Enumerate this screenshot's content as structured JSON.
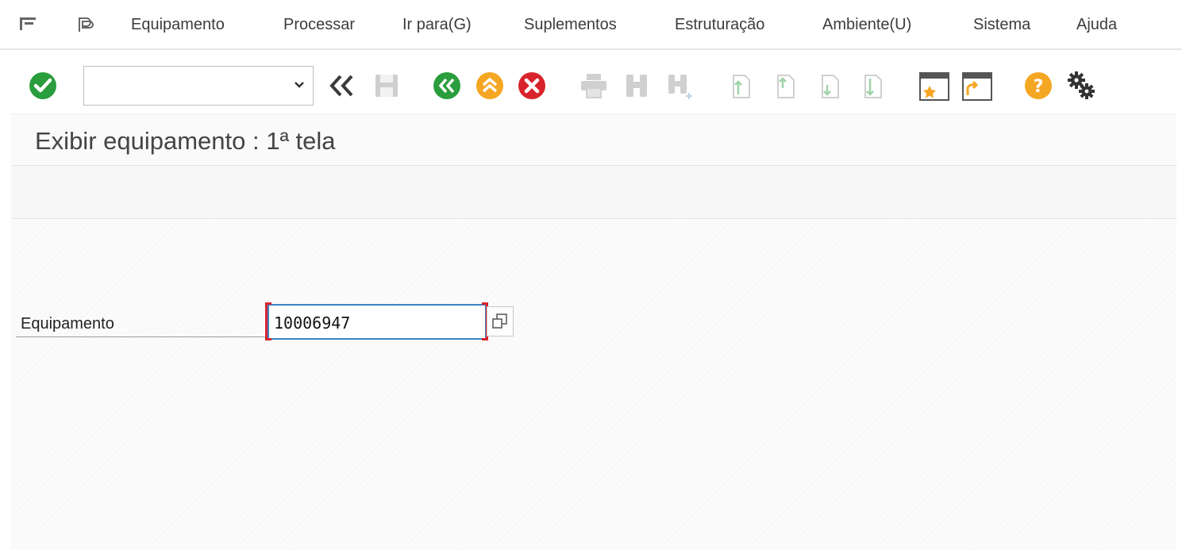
{
  "menu": {
    "items": [
      {
        "label": "Equipamento"
      },
      {
        "label": "Processar"
      },
      {
        "label": "Ir para(G)"
      },
      {
        "label": "Suplementos"
      },
      {
        "label": "Estruturação"
      },
      {
        "label": "Ambiente(U)"
      },
      {
        "label": "Sistema"
      },
      {
        "label": "Ajuda"
      }
    ],
    "icons": [
      "menu-toggle-icon",
      "session-icon"
    ]
  },
  "toolbar": {
    "command_field": {
      "value": "",
      "placeholder": ""
    },
    "icons": [
      "enter-icon",
      "command-dropdown-icon",
      "collapse-icon",
      "save-icon",
      "back-icon",
      "exit-icon",
      "cancel-icon",
      "print-icon",
      "find-icon",
      "find-next-icon",
      "first-page-icon",
      "previous-page-icon",
      "next-page-icon",
      "last-page-icon",
      "create-session-icon",
      "shortcut-icon",
      "help-icon",
      "settings-icon"
    ]
  },
  "title": "Exibir equipamento : 1ª tela",
  "form": {
    "equipment_label": "Equipamento",
    "equipment_value": "10006947"
  },
  "colors": {
    "green": "#2a9d3c",
    "orange": "#f5a623",
    "red": "#d9232c",
    "focus_blue": "#3b83c6"
  }
}
